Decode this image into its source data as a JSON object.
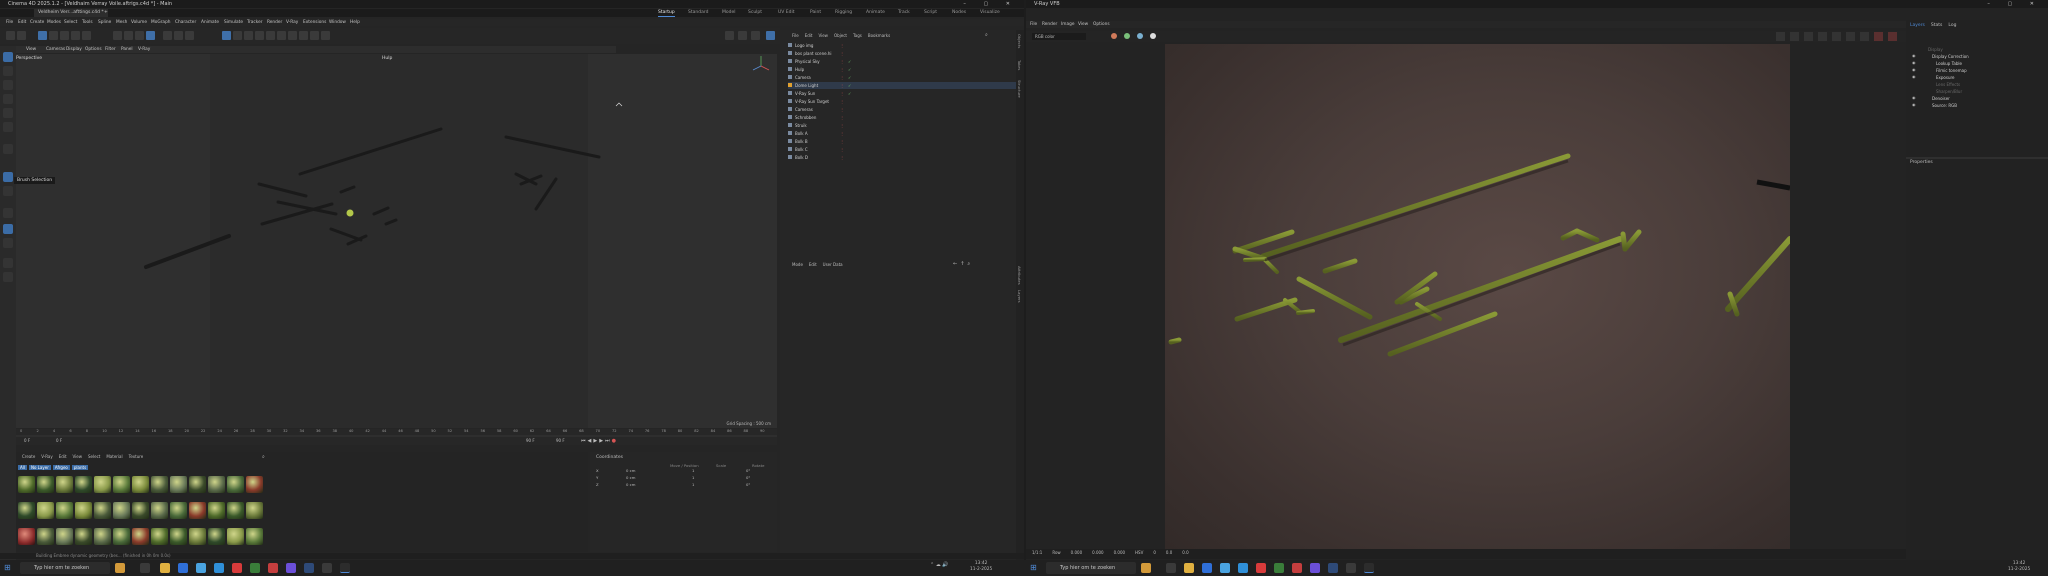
{
  "c4d": {
    "title": "Cinema 4D 2025.1.2 - [Veldhaim Verray Voile.aftrigs.c4d *] - Main",
    "doc_tabs": [
      "Veldheim Verr...afttings.c4d *",
      "+"
    ],
    "layout_tabs": [
      "Startup",
      "Standard",
      "Model",
      "Sculpt",
      "UV Edit",
      "Paint",
      "Rigging",
      "Animate",
      "Track",
      "Script",
      "Nodes",
      "Visualize"
    ],
    "active_layout": "Startup",
    "menu": [
      "File",
      "Edit",
      "Create",
      "Modes",
      "Select",
      "Tools",
      "Spline",
      "Mesh",
      "Volume",
      "MoGraph",
      "Character",
      "Animate",
      "Simulate",
      "Tracker",
      "Render",
      "V-Ray",
      "Extensions",
      "Window",
      "Help"
    ],
    "viewport_menu": [
      "View",
      "Cameras",
      "Display",
      "Options",
      "Filter",
      "Panel",
      "V-Ray"
    ],
    "viewport_label": "Perspective",
    "viewport_camera": "Hulp",
    "tooltip": "Brush Selection",
    "grid_spacing": "Grid Spacing : 500 cm",
    "timeline_ticks": [
      "0",
      "2",
      "4",
      "6",
      "8",
      "10",
      "12",
      "14",
      "16",
      "18",
      "20",
      "22",
      "24",
      "26",
      "28",
      "30",
      "32",
      "34",
      "36",
      "38",
      "40",
      "42",
      "44",
      "46",
      "48",
      "50",
      "52",
      "54",
      "56",
      "58",
      "60",
      "62",
      "64",
      "66",
      "68",
      "70",
      "72",
      "74",
      "76",
      "78",
      "80",
      "82",
      "84",
      "86",
      "88",
      "90"
    ],
    "frame_start": "0 F",
    "frame_cur": "0 F",
    "frame_end": "90 F",
    "frame_end2": "90 F",
    "material_menu": [
      "Create",
      "V-Ray",
      "Edit",
      "View",
      "Select",
      "Material",
      "Texture"
    ],
    "material_filters": [
      "All",
      "No Layer",
      "Afrgeo",
      "plants"
    ],
    "coords_title": "Coordinates",
    "coords_headers": [
      "Move / Position",
      "Scale",
      "Rotate"
    ],
    "coords_rows": [
      [
        "X",
        "0 cm",
        "1",
        "0°"
      ],
      [
        "Y",
        "0 cm",
        "1",
        "0°"
      ],
      [
        "Z",
        "0 cm",
        "1",
        "0°"
      ]
    ],
    "object_menu": [
      "File",
      "Edit",
      "View",
      "Object",
      "Tags",
      "Bookmarks"
    ],
    "objects": [
      "Logo img",
      "bos plant scene.hi",
      "Physical Sky",
      "Hulp",
      "Camera",
      "Dome Light",
      "V-Ray Sun",
      "V-Ray Sun Target",
      "Cameras",
      "Schrobben",
      "Struik",
      "Bolk A",
      "Bolk B",
      "Bolk C",
      "Bolk D"
    ],
    "attr_menu": [
      "Mode",
      "Edit",
      "User Data"
    ],
    "side_tabs": [
      "Objects",
      "Takes",
      "Structure",
      "Attributes",
      "Layers"
    ],
    "status": "Building Embree dynamic geometry (bes... (finished in 0h 0m 0.0s)"
  },
  "vray": {
    "title": "V-Ray VFB",
    "menu": [
      "File",
      "Render",
      "Image",
      "View",
      "Options"
    ],
    "channel": "RGB color",
    "right_tabs": [
      "Layers",
      "Stats",
      "Log"
    ],
    "layers": [
      "Display",
      "Display Correction",
      "Lookup Table",
      "Filmic tonemap",
      "Exposure",
      "Lens Effects",
      "Sharpen/Blur",
      "Denoiser",
      "Source: RGB"
    ],
    "layer_enabled": [
      false,
      true,
      true,
      true,
      true,
      false,
      false,
      true,
      true
    ],
    "properties_label": "Properties",
    "status_items": [
      "1/1:1",
      "Row",
      "0.000",
      "0.000",
      "0.000",
      "HSV",
      "0",
      "0.0",
      "0.0"
    ]
  },
  "taskbar": {
    "search_placeholder": "Typ hier om te zoeken",
    "time": "13:42",
    "date": "11-2-2025"
  },
  "colors": {
    "accent": "#4f8ad6",
    "hedge": "#6e7a2a",
    "render_bg": "#4a3d3a"
  }
}
